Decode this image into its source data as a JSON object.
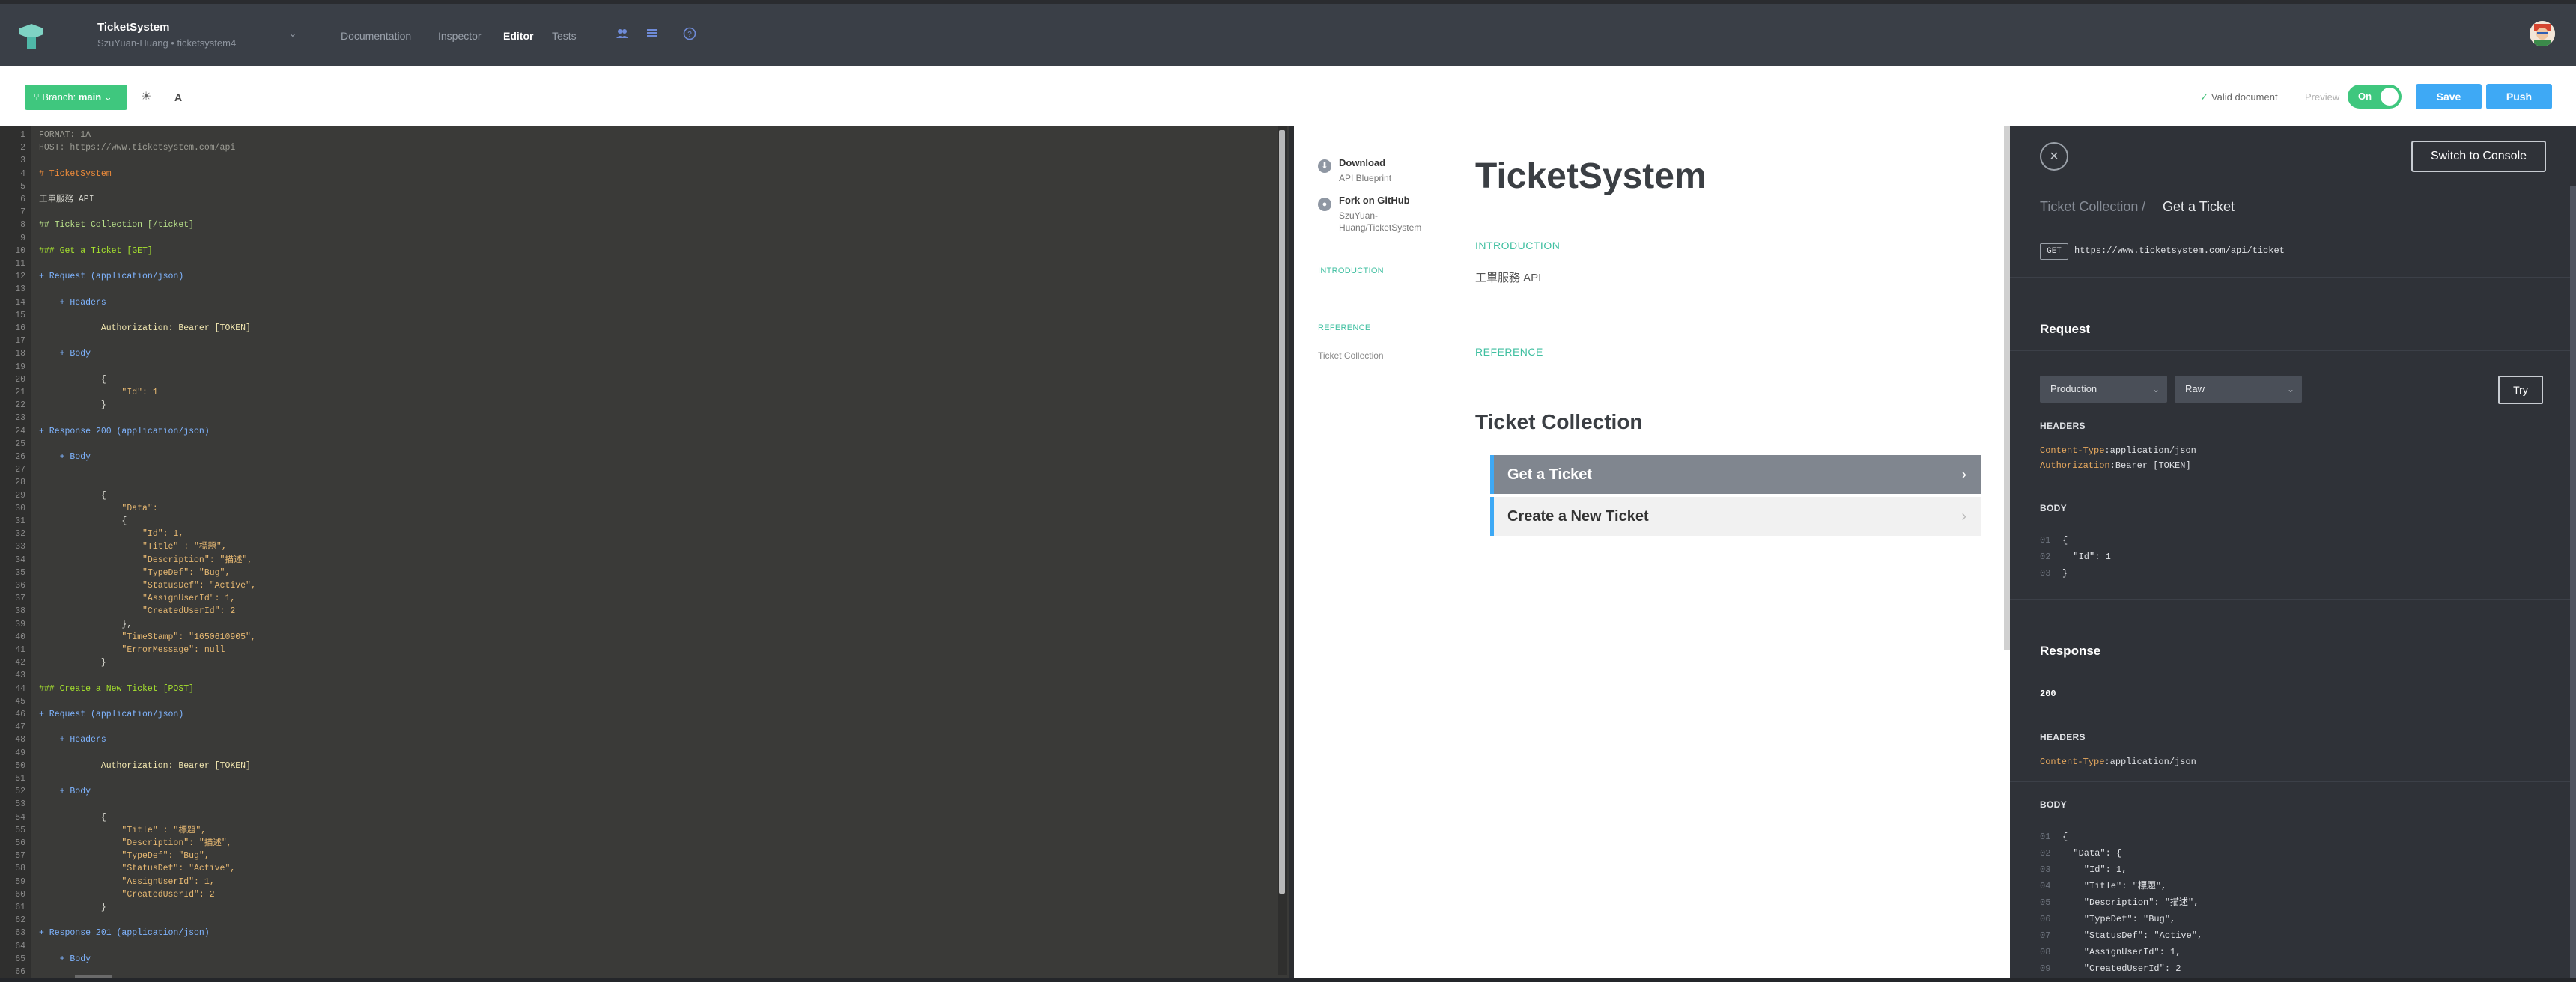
{
  "header": {
    "project_title": "TicketSystem",
    "project_subtitle": "SzuYuan-Huang • ticketsystem4",
    "nav": [
      "Documentation",
      "Inspector",
      "Editor",
      "Tests"
    ]
  },
  "toolbar": {
    "branch_prefix": "Branch:",
    "branch_name": "main",
    "font_toggle": "A",
    "valid_document": "Valid document",
    "preview_label": "Preview",
    "preview_toggle": "On",
    "save": "Save",
    "push": "Push"
  },
  "editor": {
    "lines": [
      "FORMAT: 1A",
      "HOST: https://www.ticketsystem.com/api",
      "",
      "# TicketSystem",
      "",
      "工單服務 API",
      "",
      "## Ticket Collection [/ticket]",
      "",
      "### Get a Ticket [GET]",
      "",
      "+ Request (application/json)",
      "",
      "    + Headers",
      "",
      "            Authorization: Bearer [TOKEN]",
      "",
      "    + Body",
      "",
      "            {",
      "                \"Id\": 1",
      "            }",
      "",
      "+ Response 200 (application/json)",
      "",
      "    + Body",
      "",
      "",
      "            {",
      "                \"Data\":",
      "                {",
      "                    \"Id\": 1,",
      "                    \"Title\" : \"標題\",",
      "                    \"Description\": \"描述\",",
      "                    \"TypeDef\": \"Bug\",",
      "                    \"StatusDef\": \"Active\",",
      "                    \"AssignUserId\": 1,",
      "                    \"CreatedUserId\": 2",
      "                },",
      "                \"TimeStamp\": \"1650610905\",",
      "                \"ErrorMessage\": null",
      "            }",
      "",
      "### Create a New Ticket [POST]",
      "",
      "+ Request (application/json)",
      "",
      "    + Headers",
      "",
      "            Authorization: Bearer [TOKEN]",
      "",
      "    + Body",
      "",
      "            {",
      "                \"Title\" : \"標題\",",
      "                \"Description\": \"描述\",",
      "                \"TypeDef\": \"Bug\",",
      "                \"StatusDef\": \"Active\",",
      "                \"AssignUserId\": 1,",
      "                \"CreatedUserId\": 2",
      "            }",
      "",
      "+ Response 201 (application/json)",
      "",
      "    + Body",
      "",
      "            {",
      "                \"Data\":"
    ]
  },
  "preview": {
    "download_title": "Download",
    "download_sub": "API Blueprint",
    "fork_title": "Fork on GitHub",
    "fork_sub_1": "SzuYuan-",
    "fork_sub_2": "Huang/TicketSystem",
    "side_introduction": "INTRODUCTION",
    "side_reference": "REFERENCE",
    "side_item": "Ticket Collection",
    "title": "TicketSystem",
    "introduction_heading": "INTRODUCTION",
    "introduction_text": "工單服務 API",
    "reference_heading": "REFERENCE",
    "collection_title": "Ticket Collection",
    "actions": [
      "Get a Ticket",
      "Create a New Ticket"
    ]
  },
  "console": {
    "switch_button": "Switch to Console",
    "breadcrumb_parent": "Ticket Collection",
    "breadcrumb_sep": "/",
    "breadcrumb_current": "Get a Ticket",
    "method": "GET",
    "url": "https://www.ticketsystem.com/api/ticket",
    "request_heading": "Request",
    "environment": "Production",
    "format": "Raw",
    "try_button": "Try",
    "headers_label": "HEADERS",
    "request_headers": [
      {
        "key": "Content-Type",
        "value": "application/json"
      },
      {
        "key": "Authorization",
        "value": "Bearer [TOKEN]"
      }
    ],
    "body_label": "BODY",
    "request_body": [
      {
        "n": "01",
        "text": "{"
      },
      {
        "n": "02",
        "text": "  \"Id\": 1"
      },
      {
        "n": "03",
        "text": "}"
      }
    ],
    "response_heading": "Response",
    "status": "200",
    "response_headers_label": "HEADERS",
    "response_headers": [
      {
        "key": "Content-Type",
        "value": "application/json"
      }
    ],
    "response_body_label": "BODY",
    "response_body": [
      {
        "n": "01",
        "text": "{"
      },
      {
        "n": "02",
        "text": "  \"Data\": {"
      },
      {
        "n": "03",
        "text": "    \"Id\": 1,"
      },
      {
        "n": "04",
        "text": "    \"Title\": \"標題\","
      },
      {
        "n": "05",
        "text": "    \"Description\": \"描述\","
      },
      {
        "n": "06",
        "text": "    \"TypeDef\": \"Bug\","
      },
      {
        "n": "07",
        "text": "    \"StatusDef\": \"Active\","
      },
      {
        "n": "08",
        "text": "    \"AssignUserId\": 1,"
      },
      {
        "n": "09",
        "text": "    \"CreatedUserId\": 2"
      }
    ]
  },
  "colors": {
    "accent_green": "#3fc77e",
    "accent_blue": "#3ea9f5",
    "teal": "#3fbfa0",
    "editor_bg": "#3a3a38",
    "console_bg": "#2f3238"
  }
}
